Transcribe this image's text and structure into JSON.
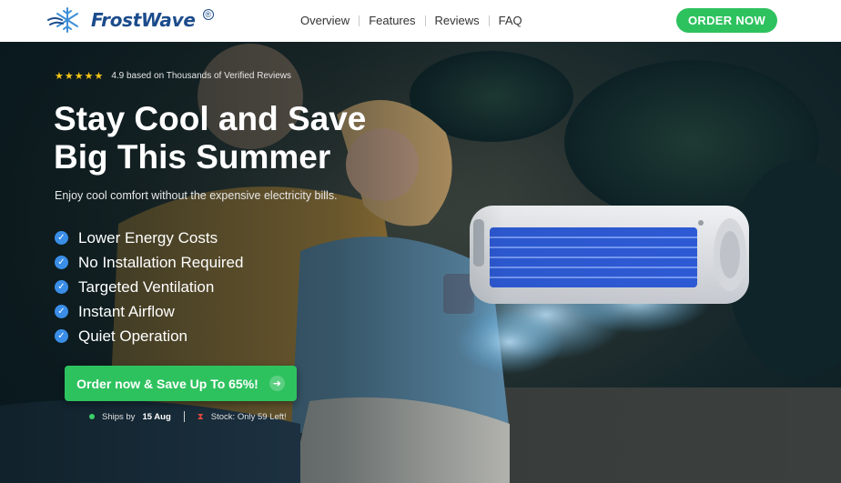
{
  "brand": {
    "name": "FrostWave",
    "mark": "®"
  },
  "nav": {
    "items": [
      "Overview",
      "Features",
      "Reviews",
      "FAQ"
    ],
    "cta": "ORDER NOW"
  },
  "hero": {
    "rating_stars": "★★★★★",
    "rating_text": "4.9 based on Thousands of Verified Reviews",
    "title_line1": "Stay Cool and Save",
    "title_line2": "Big This Summer",
    "subtitle": "Enjoy cool comfort without the expensive electricity bills.",
    "features": [
      "Lower Energy Costs",
      "No Installation Required",
      "Targeted Ventilation",
      "Instant Airflow",
      "Quiet Operation"
    ],
    "cta": "Order now & Save Up To 65%!",
    "ships_prefix": "Ships by",
    "ships_date": "15 Aug",
    "stock_text": "Stock: Only 59 Left!"
  },
  "colors": {
    "accent_green": "#2ec25f",
    "brand_blue": "#1c4c8c",
    "check_blue": "#3a8ee8",
    "star_gold": "#f5c518"
  }
}
